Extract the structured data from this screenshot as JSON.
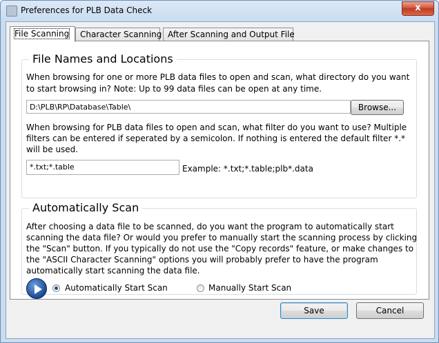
{
  "window": {
    "title": "Preferences for PLB Data Check",
    "close_glyph": "x"
  },
  "tabs": [
    {
      "label": "File Scanning",
      "active": true
    },
    {
      "label": "Character Scanning",
      "active": false
    },
    {
      "label": "After Scanning and Output File",
      "active": false
    }
  ],
  "file_names": {
    "heading": "File Names and Locations",
    "directory_line1": "When browsing for one or more PLB data files to open and scan, what directory do you want",
    "directory_line2": "to start browsing in?  Note: Up to 99 data files can be open at any time.",
    "directory_value": "D:\\PLB\\RP\\Database\\Table\\",
    "browse_label": "Browse...",
    "filter_line1": "When browsing for PLB data files to open and scan, what filter do you want to use?  Multiple",
    "filter_line2": "filters can be entered if seperated by a semicolon.  If nothing is entered the default filter *.*",
    "filter_line3": "will be used.",
    "filter_value": "*.txt;*.table",
    "filter_example": "Example: *.txt;*.table;plb*.data"
  },
  "auto_scan": {
    "heading": "Automatically Scan",
    "description_lines": [
      "After choosing a data file to be scanned, do you want the program to automatically start",
      "scanning the data file?  Or would you prefer to manually start the scanning process by clicking",
      "the \"Scan\" button.  If you typically do not use the \"Copy records\" feature, or make changes to",
      "the \"ASCII Character Scanning\" options you will probably prefer to have the program",
      "automatically start scanning the data file."
    ],
    "option_auto": "Automatically Start Scan",
    "option_manual": "Manually Start Scan",
    "selected": "auto"
  },
  "footer": {
    "save_label": "Save",
    "cancel_label": "Cancel"
  },
  "colors": {
    "accent": "#3c7fb1",
    "close": "#c13a1f"
  }
}
